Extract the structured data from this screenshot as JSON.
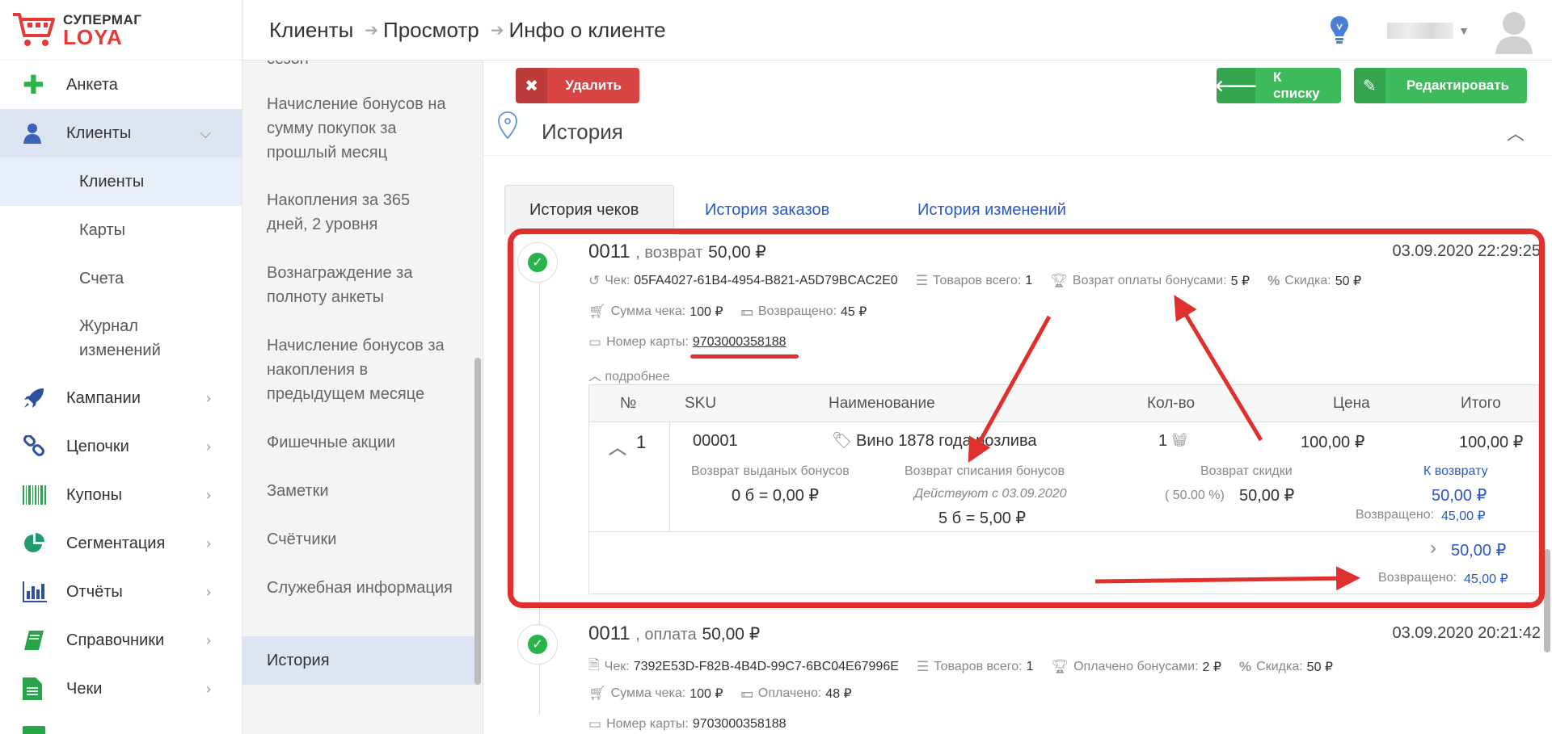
{
  "logo": {
    "top": "СУПЕРМАГ",
    "bottom": "LOYA"
  },
  "header": {
    "breadcrumbs": [
      "Клиенты",
      "Просмотр",
      "Инфо о клиенте"
    ]
  },
  "sidebar": {
    "items": [
      {
        "label": "Анкета",
        "icon": "plus-icon"
      },
      {
        "label": "Клиенты",
        "icon": "user-icon",
        "active": true
      },
      {
        "label": "Кампании",
        "icon": "rocket-icon"
      },
      {
        "label": "Цепочки",
        "icon": "chain-icon"
      },
      {
        "label": "Купоны",
        "icon": "barcode-icon"
      },
      {
        "label": "Сегментация",
        "icon": "pie-icon"
      },
      {
        "label": "Отчёты",
        "icon": "barchart-icon"
      },
      {
        "label": "Справочники",
        "icon": "book-icon"
      },
      {
        "label": "Чеки",
        "icon": "doc-icon"
      }
    ],
    "subitems": [
      "Клиенты",
      "Карты",
      "Счета",
      "Журнал изменений"
    ]
  },
  "subcol": {
    "partial_top": "сезон",
    "items": [
      "Начисление бонусов на сумму покупок за прошлый месяц",
      "Накопления за 365 дней, 2 уровня",
      "Вознаграждение за полноту анкеты",
      "Начисление бонусов за накопления в предыдущем месяце",
      "Фишечные акции",
      "Заметки",
      "Счётчики",
      "Служебная информация",
      "История"
    ]
  },
  "toolbar": {
    "delete": "Удалить",
    "to_list": "К списку",
    "edit": "Редактировать"
  },
  "section": {
    "title": "История"
  },
  "tabs": [
    "История чеков",
    "История заказов",
    "История изменений"
  ],
  "receipt1": {
    "number": "0011",
    "op": ", возврат",
    "amount": "50,00 ₽",
    "date": "03.09.2020 22:29:25",
    "check_label": "Чек:",
    "check_id": "05FA4027-61B4-4954-B821-A5D79BCAC2E0",
    "goods_label": "Товаров всего:",
    "goods": "1",
    "bonus_label": "Возрат оплаты бонусами:",
    "bonus": "5 ₽",
    "discount_label": "Скидка:",
    "discount": "50 ₽",
    "sum_label": "Сумма чека:",
    "sum": "100 ₽",
    "returned_label": "Возвращено:",
    "returned": "45 ₽",
    "card_label": "Номер карты:",
    "card": "9703000358188",
    "more": "подробнее",
    "table": {
      "headers": [
        "№",
        "SKU",
        "Наименование",
        "Кол-во",
        "Цена",
        "Итого"
      ],
      "row": {
        "num": "1",
        "sku": "00001",
        "name": "Вино 1878 года розлива",
        "qty": "1",
        "price": "100,00 ₽",
        "total": "100,00 ₽",
        "ret_issued_label": "Возврат выданых бонусов",
        "ret_issued": "0 б = 0,00 ₽",
        "ret_spent_label": "Возврат списания бонусов",
        "ret_spent_note": "Действуют с 03.09.2020",
        "ret_spent": "5 б = 5,00 ₽",
        "ret_disc_label": "Возврат скидки",
        "ret_disc_pct": "( 50.00 %)",
        "ret_disc": "50,00 ₽",
        "to_return_label": "К возврату",
        "to_return": "50,00 ₽",
        "returned_label": "Возвращено:",
        "returned": "45,00 ₽"
      },
      "footer": {
        "total": "50,00 ₽",
        "returned_label": "Возвращено:",
        "returned": "45,00 ₽"
      }
    }
  },
  "receipt2": {
    "number": "0011",
    "op": ", оплата",
    "amount": "50,00 ₽",
    "date": "03.09.2020 20:21:42",
    "check_label": "Чек:",
    "check_id": "7392E53D-F82B-4B4D-99C7-6BC04E67996E",
    "goods_label": "Товаров всего:",
    "goods": "1",
    "bonus_label": "Оплачено бонусами:",
    "bonus": "2 ₽",
    "discount_label": "Скидка:",
    "discount": "50 ₽",
    "sum_label": "Сумма чека:",
    "sum": "100 ₽",
    "paid_label": "Оплачено:",
    "paid": "48 ₽",
    "card_label": "Номер карты:",
    "card": "9703000358188"
  },
  "colors": {
    "accent_blue": "#2a57c6",
    "green": "#3dbb5b",
    "red": "#d84343",
    "annotation": "#e0302e"
  }
}
